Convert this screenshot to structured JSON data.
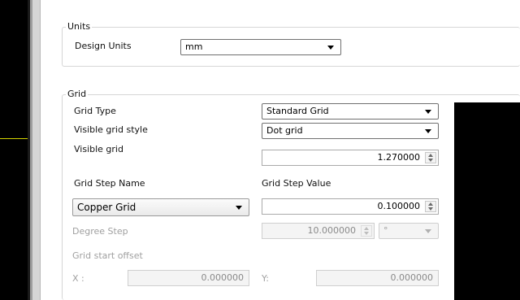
{
  "units": {
    "group_title": "Units",
    "design_units_label": "Design Units",
    "design_units_value": "mm"
  },
  "grid": {
    "group_title": "Grid",
    "grid_type_label": "Grid Type",
    "grid_type_value": "Standard Grid",
    "visible_grid_style_label": "Visible grid style",
    "visible_grid_style_value": "Dot grid",
    "visible_grid_label": "Visible grid",
    "visible_grid_value": "1.270000",
    "grid_step_name_label": "Grid Step Name",
    "grid_step_value_label": "Grid Step Value",
    "grid_step_name_value": "Copper Grid",
    "grid_step_value": "0.100000",
    "degree_step_label": "Degree Step",
    "degree_step_value": "10.000000",
    "degree_unit_value": "°",
    "grid_start_offset_label": "Grid start offset",
    "x_label": "X :",
    "x_value": "0.000000",
    "y_label": "Y:",
    "y_value": "0.000000"
  },
  "colors": {
    "editor_background": "#000000",
    "guide_line": "#d4d400",
    "preview_background": "#000000"
  }
}
